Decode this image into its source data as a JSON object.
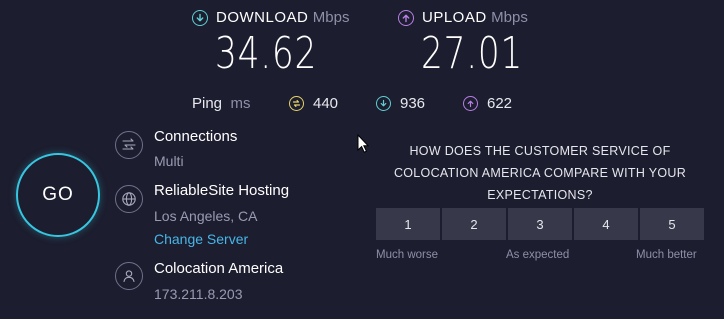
{
  "download": {
    "label": "DOWNLOAD",
    "unit": "Mbps",
    "value": "34.62"
  },
  "upload": {
    "label": "UPLOAD",
    "unit": "Mbps",
    "value": "27.01"
  },
  "ping": {
    "label": "Ping",
    "unit": "ms",
    "idle": "440",
    "download": "936",
    "upload": "622"
  },
  "go": {
    "label": "GO"
  },
  "connections": {
    "title": "Connections",
    "value": "Multi"
  },
  "server": {
    "title": "ReliableSite Hosting",
    "location": "Los Angeles, CA",
    "change_link": "Change Server"
  },
  "isp": {
    "title": "Colocation America",
    "ip": "173.211.8.203"
  },
  "survey": {
    "question": "HOW DOES THE CUSTOMER SERVICE OF COLOCATION AMERICA COMPARE WITH YOUR EXPECTATIONS?",
    "options": [
      "1",
      "2",
      "3",
      "4",
      "5"
    ],
    "caption_low": "Much worse",
    "caption_mid": "As expected",
    "caption_high": "Much better"
  },
  "colors": {
    "background": "#1c1d2e",
    "download_accent": "#5fd0d3",
    "upload_accent": "#b87ee6",
    "idle_accent": "#e6d36a",
    "go_ring": "#36c6e0",
    "link": "#47b6e8"
  },
  "icons": {
    "download": "download-arrow-icon",
    "upload": "upload-arrow-icon",
    "ping_idle": "ping-idle-icon",
    "connections": "connections-icon",
    "server": "globe-icon",
    "isp": "user-icon"
  }
}
